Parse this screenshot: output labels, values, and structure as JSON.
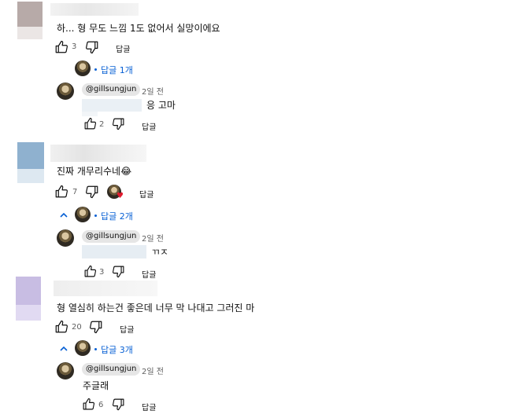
{
  "comments": [
    {
      "text": "하... 형 무도 느낌 1도 없어서 실망이에요",
      "likes": "3",
      "reply_label": "답글",
      "replies_toggle": "답글 1개",
      "reply": {
        "handle": "@gillsungjun",
        "date": "2일 전",
        "text": "응 고마",
        "likes": "2",
        "reply_label": "답글"
      }
    },
    {
      "text": "진짜 개무리수네😂",
      "likes": "7",
      "reply_label": "답글",
      "replies_toggle": "답글 2개",
      "reply": {
        "handle": "@gillsungjun",
        "date": "2일 전",
        "text": "ㄲㅈ",
        "likes": "3",
        "reply_label": "답글"
      }
    },
    {
      "text": "형 열심히 하는건 좋은데 너무 막 나대고 그러진 마",
      "likes": "20",
      "reply_label": "답글",
      "replies_toggle": "답글 3개",
      "reply": {
        "handle": "@gillsungjun",
        "date": "2일 전",
        "text": "주글래",
        "likes": "6",
        "reply_label": "답글"
      }
    }
  ],
  "icons": {
    "like": "thumbs-up-icon",
    "dislike": "thumbs-down-icon",
    "expand": "chevron-up-icon",
    "heart": "heart-icon"
  },
  "colors": {
    "link_blue": "#065fd4",
    "text": "#0f0f0f",
    "secondary": "#606060",
    "heart": "#e01b2e"
  }
}
